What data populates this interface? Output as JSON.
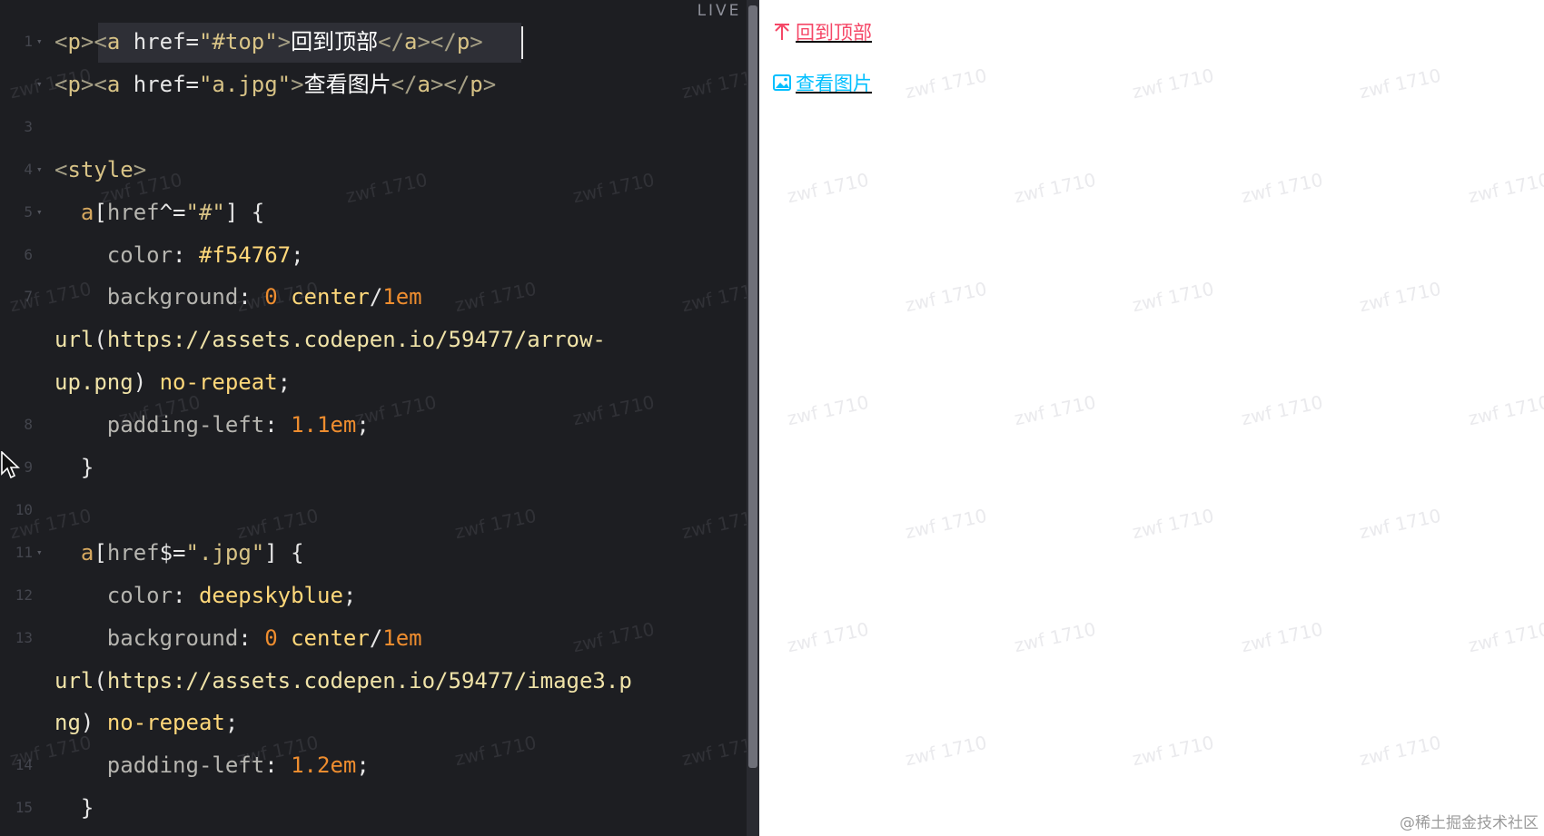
{
  "editor": {
    "live_label": "LIVE",
    "lines": [
      {
        "n": "1",
        "fold": true,
        "segments": [
          {
            "c": "t-angle",
            "t": "<"
          },
          {
            "c": "t-tag",
            "t": "p"
          },
          {
            "c": "t-angle",
            "t": "><"
          },
          {
            "c": "t-tag",
            "t": "a"
          },
          {
            "c": "t-attr",
            "t": " href="
          },
          {
            "c": "t-str",
            "t": "\"#top\""
          },
          {
            "c": "t-angle",
            "t": ">"
          },
          {
            "c": "t-text",
            "t": "回到顶部"
          },
          {
            "c": "t-angle",
            "t": "</"
          },
          {
            "c": "t-tag",
            "t": "a"
          },
          {
            "c": "t-angle",
            "t": "></"
          },
          {
            "c": "t-tag",
            "t": "p"
          },
          {
            "c": "t-angle",
            "t": ">"
          }
        ]
      },
      {
        "n": "",
        "fold": true,
        "segments": [
          {
            "c": "t-angle",
            "t": "<"
          },
          {
            "c": "t-tag",
            "t": "p"
          },
          {
            "c": "t-angle",
            "t": "><"
          },
          {
            "c": "t-tag",
            "t": "a"
          },
          {
            "c": "t-attr",
            "t": " href="
          },
          {
            "c": "t-str",
            "t": "\"a.jpg\""
          },
          {
            "c": "t-angle",
            "t": ">"
          },
          {
            "c": "t-text",
            "t": "查看图片"
          },
          {
            "c": "t-angle",
            "t": "</"
          },
          {
            "c": "t-tag",
            "t": "a"
          },
          {
            "c": "t-angle",
            "t": "></"
          },
          {
            "c": "t-tag",
            "t": "p"
          },
          {
            "c": "t-angle",
            "t": ">"
          }
        ]
      },
      {
        "n": "3",
        "fold": false,
        "segments": []
      },
      {
        "n": "4",
        "fold": true,
        "segments": [
          {
            "c": "t-angle",
            "t": "<"
          },
          {
            "c": "t-tag",
            "t": "style"
          },
          {
            "c": "t-angle",
            "t": ">"
          }
        ]
      },
      {
        "n": "5",
        "fold": true,
        "segments": [
          {
            "c": "t-punc",
            "t": "  "
          },
          {
            "c": "t-sel",
            "t": "a"
          },
          {
            "c": "t-punc",
            "t": "["
          },
          {
            "c": "t-prop",
            "t": "href"
          },
          {
            "c": "t-punc",
            "t": "^="
          },
          {
            "c": "t-str",
            "t": "\"#\""
          },
          {
            "c": "t-punc",
            "t": "] {"
          }
        ]
      },
      {
        "n": "6",
        "fold": false,
        "segments": [
          {
            "c": "t-punc",
            "t": "    "
          },
          {
            "c": "t-prop",
            "t": "color"
          },
          {
            "c": "t-punc",
            "t": ": "
          },
          {
            "c": "t-val",
            "t": "#f54767"
          },
          {
            "c": "t-punc",
            "t": ";"
          }
        ]
      },
      {
        "n": "7",
        "fold": false,
        "segments": [
          {
            "c": "t-punc",
            "t": "    "
          },
          {
            "c": "t-prop",
            "t": "background"
          },
          {
            "c": "t-punc",
            "t": ": "
          },
          {
            "c": "t-num",
            "t": "0"
          },
          {
            "c": "t-val",
            "t": " center"
          },
          {
            "c": "t-punc",
            "t": "/"
          },
          {
            "c": "t-num",
            "t": "1em"
          }
        ]
      },
      {
        "n": "",
        "fold": false,
        "segments": [
          {
            "c": "t-url",
            "t": "url"
          },
          {
            "c": "t-punc",
            "t": "("
          },
          {
            "c": "t-url",
            "t": "https://assets.codepen.io/59477/arrow-"
          }
        ]
      },
      {
        "n": "",
        "fold": false,
        "segments": [
          {
            "c": "t-url",
            "t": "up.png"
          },
          {
            "c": "t-punc",
            "t": ") "
          },
          {
            "c": "t-val",
            "t": "no-repeat"
          },
          {
            "c": "t-punc",
            "t": ";"
          }
        ]
      },
      {
        "n": "8",
        "fold": false,
        "segments": [
          {
            "c": "t-punc",
            "t": "    "
          },
          {
            "c": "t-prop",
            "t": "padding-left"
          },
          {
            "c": "t-punc",
            "t": ": "
          },
          {
            "c": "t-num",
            "t": "1.1em"
          },
          {
            "c": "t-punc",
            "t": ";"
          }
        ]
      },
      {
        "n": "9",
        "fold": false,
        "segments": [
          {
            "c": "t-punc",
            "t": "  }"
          }
        ]
      },
      {
        "n": "10",
        "fold": false,
        "segments": []
      },
      {
        "n": "11",
        "fold": true,
        "segments": [
          {
            "c": "t-punc",
            "t": "  "
          },
          {
            "c": "t-sel",
            "t": "a"
          },
          {
            "c": "t-punc",
            "t": "["
          },
          {
            "c": "t-prop",
            "t": "href"
          },
          {
            "c": "t-punc",
            "t": "$="
          },
          {
            "c": "t-str",
            "t": "\".jpg\""
          },
          {
            "c": "t-punc",
            "t": "] {"
          }
        ]
      },
      {
        "n": "12",
        "fold": false,
        "segments": [
          {
            "c": "t-punc",
            "t": "    "
          },
          {
            "c": "t-prop",
            "t": "color"
          },
          {
            "c": "t-punc",
            "t": ": "
          },
          {
            "c": "t-val",
            "t": "deepskyblue"
          },
          {
            "c": "t-punc",
            "t": ";"
          }
        ]
      },
      {
        "n": "13",
        "fold": false,
        "segments": [
          {
            "c": "t-punc",
            "t": "    "
          },
          {
            "c": "t-prop",
            "t": "background"
          },
          {
            "c": "t-punc",
            "t": ": "
          },
          {
            "c": "t-num",
            "t": "0"
          },
          {
            "c": "t-val",
            "t": " center"
          },
          {
            "c": "t-punc",
            "t": "/"
          },
          {
            "c": "t-num",
            "t": "1em"
          }
        ]
      },
      {
        "n": "",
        "fold": false,
        "segments": [
          {
            "c": "t-url",
            "t": "url"
          },
          {
            "c": "t-punc",
            "t": "("
          },
          {
            "c": "t-url",
            "t": "https://assets.codepen.io/59477/image3.p"
          }
        ]
      },
      {
        "n": "",
        "fold": false,
        "segments": [
          {
            "c": "t-url",
            "t": "ng"
          },
          {
            "c": "t-punc",
            "t": ") "
          },
          {
            "c": "t-val",
            "t": "no-repeat"
          },
          {
            "c": "t-punc",
            "t": ";"
          }
        ]
      },
      {
        "n": "14",
        "fold": false,
        "segments": [
          {
            "c": "t-punc",
            "t": "    "
          },
          {
            "c": "t-prop",
            "t": "padding-left"
          },
          {
            "c": "t-punc",
            "t": ": "
          },
          {
            "c": "t-num",
            "t": "1.2em"
          },
          {
            "c": "t-punc",
            "t": ";"
          }
        ]
      },
      {
        "n": "15",
        "fold": false,
        "segments": [
          {
            "c": "t-punc",
            "t": "  }"
          }
        ]
      }
    ]
  },
  "preview": {
    "link_top": {
      "label": "回到顶部",
      "color": "#f54767",
      "icon": "arrow-up-icon"
    },
    "link_img": {
      "label": "查看图片",
      "color": "deepskyblue",
      "icon": "image-icon"
    }
  },
  "watermark_text": "zwf 1710",
  "footer_credit": "@稀土掘金技术社区"
}
